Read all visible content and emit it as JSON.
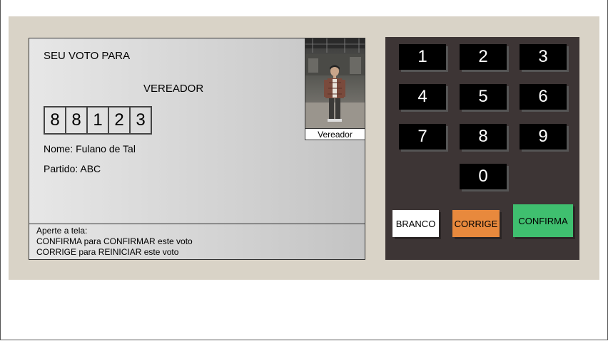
{
  "screen": {
    "voto_label": "SEU VOTO PARA",
    "cargo": "VEREADOR",
    "digits": [
      "8",
      "8",
      "1",
      "2",
      "3"
    ],
    "nome": "Nome: Fulano de Tal",
    "partido": "Partido: ABC",
    "photo_caption": "Vereador",
    "instructions": {
      "line1": "Aperte a tela:",
      "line2": "CONFIRMA para CONFIRMAR este voto",
      "line3": "CORRIGE para REINICIAR este voto"
    }
  },
  "keypad": {
    "keys": [
      "1",
      "2",
      "3",
      "4",
      "5",
      "6",
      "7",
      "8",
      "9",
      "0"
    ],
    "branco": "BRANCO",
    "corrige": "CORRIGE",
    "confirma": "CONFIRMA"
  },
  "colors": {
    "urna_bg": "#d9d3c7",
    "keypad_bg": "#3d3535",
    "branco": "#ffffff",
    "corrige": "#e8893d",
    "confirma": "#3fbf6f"
  }
}
